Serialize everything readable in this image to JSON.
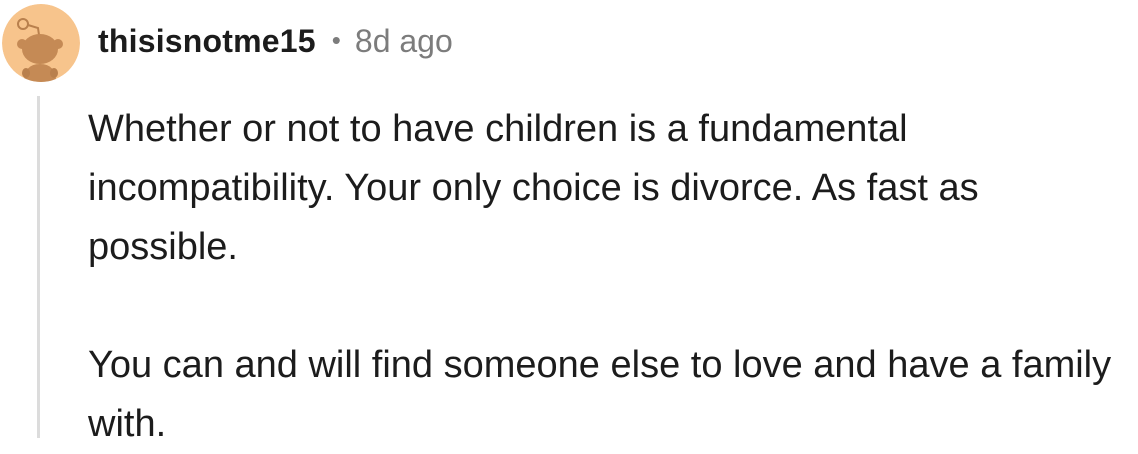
{
  "comment": {
    "author": "thisisnotme15",
    "separator": "•",
    "age": "8d ago",
    "paragraphs": [
      "Whether or not to have children is a fundamental incompatibility. Your only choice is divorce. As fast as possible.",
      "You can and will find someone else to love and have a family with."
    ],
    "avatar": {
      "icon": "snoo-avatar-icon",
      "background_color": "#f7c48c",
      "figure_color": "#c58a55"
    }
  }
}
